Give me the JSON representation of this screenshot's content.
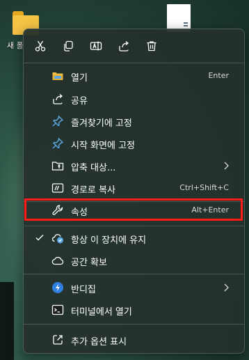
{
  "desktop": {
    "folder_label": "새 폴"
  },
  "toolbar": {
    "icons": [
      "cut-icon",
      "copy-icon",
      "rename-icon",
      "share-icon",
      "delete-icon"
    ]
  },
  "menu": {
    "open": {
      "label": "열기",
      "shortcut": "Enter"
    },
    "share": {
      "label": "공유"
    },
    "pin_quick": {
      "label": "즐겨찾기에 고정"
    },
    "pin_start": {
      "label": "시작 화면에 고정"
    },
    "compress": {
      "label": "압축 대상..."
    },
    "copy_path": {
      "label": "경로로 복사",
      "shortcut": "Ctrl+Shift+C"
    },
    "properties": {
      "label": "속성",
      "shortcut": "Alt+Enter"
    },
    "keep_device": {
      "label": "항상 이 장치에 유지"
    },
    "free_space": {
      "label": "공간 확보"
    },
    "bandizip": {
      "label": "반디집"
    },
    "terminal": {
      "label": "터미널에서 열기"
    },
    "more_options": {
      "label": "추가 옵션 표시"
    }
  },
  "colors": {
    "highlight_border": "#ff1a1a",
    "accent_blue": "#5aa9e6",
    "folder_yellow": "#f4c446"
  }
}
